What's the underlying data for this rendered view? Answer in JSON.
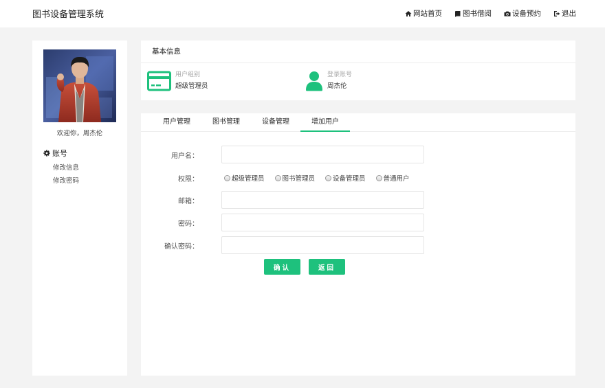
{
  "app": {
    "title": "图书设备管理系统"
  },
  "topnav": [
    {
      "label": "网站首页",
      "icon": "home-icon"
    },
    {
      "label": "图书借阅",
      "icon": "book-icon"
    },
    {
      "label": "设备预约",
      "icon": "camera-icon"
    },
    {
      "label": "退出",
      "icon": "logout-icon"
    }
  ],
  "sidebar": {
    "welcome": "欢迎你，周杰伦",
    "section": "账号",
    "links": [
      "修改信息",
      "修改密码"
    ]
  },
  "info": {
    "title": "基本信息",
    "group_label": "用户组别",
    "group_value": "超级管理员",
    "account_label": "登录账号",
    "account_value": "周杰伦"
  },
  "tabs": [
    "用户管理",
    "图书管理",
    "设备管理",
    "增加用户"
  ],
  "active_tab": "增加用户",
  "form": {
    "username_label": "用户名：",
    "username_value": "",
    "permission_label": "权限：",
    "permission_options": [
      "超级管理员",
      "图书管理员",
      "设备管理员",
      "普通用户"
    ],
    "email_label": "邮箱：",
    "email_value": "",
    "password_label": "密码：",
    "password_value": "",
    "confirm_label": "确认密码：",
    "confirm_value": "",
    "confirm_button": "确认",
    "back_button": "返回"
  },
  "colors": {
    "accent": "#1ec17d",
    "background": "#f3f3f3"
  }
}
